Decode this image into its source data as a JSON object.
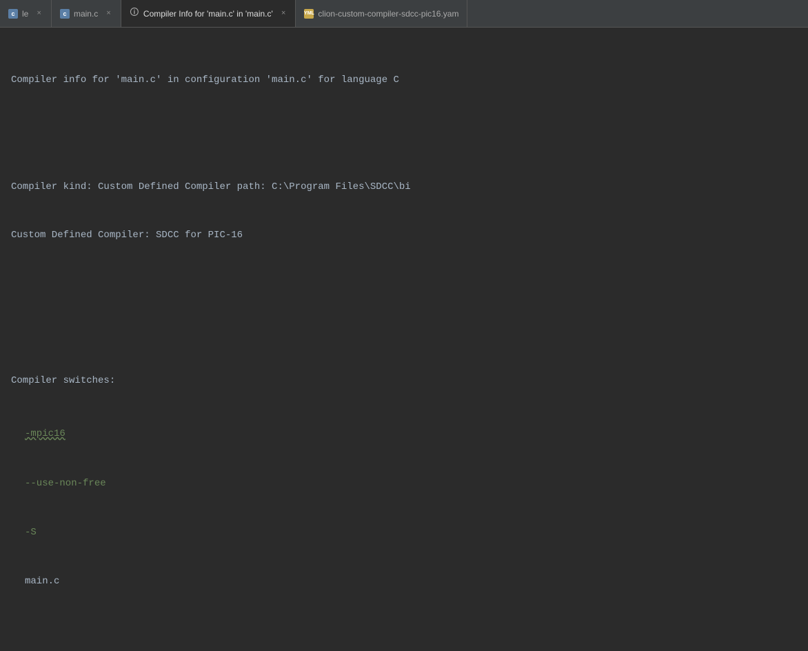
{
  "tabs": [
    {
      "id": "tab-unknown",
      "label": "le",
      "icon_type": "c",
      "icon_label": "c",
      "closeable": true,
      "active": false
    },
    {
      "id": "tab-main-c",
      "label": "main.c",
      "icon_type": "c",
      "icon_label": "c",
      "closeable": true,
      "active": false
    },
    {
      "id": "tab-compiler-info",
      "label": "Compiler Info for 'main.c' in 'main.c'",
      "icon_type": "info",
      "icon_label": "i",
      "closeable": true,
      "active": true
    },
    {
      "id": "tab-yaml",
      "label": "clion-custom-compiler-sdcc-pic16.yam",
      "icon_type": "yaml",
      "icon_label": "YML",
      "closeable": false,
      "active": false
    }
  ],
  "content": {
    "header": "Compiler info for 'main.c' in configuration 'main.c' for language C",
    "compiler_kind_line": "Compiler kind: Custom Defined Compiler path: C:\\Program Files\\SDCC\\bi",
    "compiler_defined_line": "Custom Defined Compiler: SDCC for PIC-16",
    "switches_label": "Compiler switches:",
    "switches": [
      {
        "value": "-mpic16",
        "underline": true
      },
      {
        "value": "--use-non-free",
        "underline": false
      },
      {
        "value": "-S",
        "underline": false
      }
    ],
    "filename_switch": "main.c"
  },
  "colors": {
    "background": "#2b2b2b",
    "tab_bar": "#3c3f41",
    "text_main": "#a9b7c6",
    "text_green": "#6a8759",
    "active_tab_bg": "#2b2b2b"
  }
}
